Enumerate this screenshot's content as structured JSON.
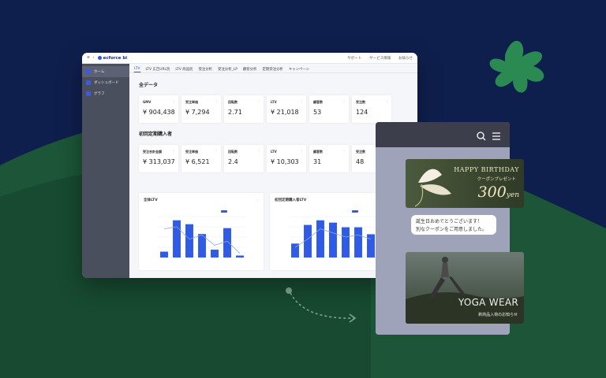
{
  "app": {
    "logo": "ecforce bi"
  },
  "topbar": {
    "support": "サポート",
    "service": "サービス情報",
    "account": "お知らせ"
  },
  "sidebar": {
    "items": [
      {
        "label": "ホーム",
        "active": true
      },
      {
        "label": "ダッシュボード",
        "active": false
      },
      {
        "label": "グラフ",
        "active": false
      }
    ]
  },
  "tabs": [
    "LTV",
    "LTV 広告URL別",
    "LTV 商品別",
    "受注分析",
    "受注分析_LP",
    "顧客分析",
    "定期受注分析",
    "キャンペーン"
  ],
  "section1": {
    "title": "全データ",
    "cards": [
      {
        "label": "GMV",
        "value": "¥ 904,438"
      },
      {
        "label": "受注単価",
        "value": "¥ 7,294"
      },
      {
        "label": "回転数",
        "value": "2.71"
      },
      {
        "label": "LTV",
        "value": "¥ 21,018"
      },
      {
        "label": "顧客数",
        "value": "53"
      },
      {
        "label": "受注数",
        "value": "124"
      }
    ]
  },
  "section2": {
    "title": "初回定期購入者",
    "cards": [
      {
        "label": "受注合計金額",
        "value": "¥ 313,037"
      },
      {
        "label": "受注単価",
        "value": "¥ 6,521"
      },
      {
        "label": "回転数",
        "value": "2.4"
      },
      {
        "label": "LTV",
        "value": "¥ 10,303"
      },
      {
        "label": "顧客数",
        "value": "31"
      },
      {
        "label": "受注数",
        "value": "48"
      }
    ]
  },
  "charts": {
    "left": {
      "title": "全体LTV"
    },
    "right": {
      "title": "初回定期購入者LTV"
    }
  },
  "chart_data": [
    {
      "type": "bar",
      "title": "全体LTV",
      "values": [
        3,
        19,
        17,
        12,
        4,
        15,
        1
      ],
      "line": [
        0.7,
        0.75,
        0.45,
        0.55,
        0.3,
        0.4,
        0.1
      ]
    },
    {
      "type": "bar",
      "title": "初回定期購入者LTV",
      "values": [
        6,
        14,
        16,
        15,
        13,
        13,
        10
      ],
      "line": [
        0.25,
        0.45,
        0.7,
        0.6,
        0.5,
        0.55,
        0.45
      ]
    }
  ],
  "promo": {
    "bday_title": "HAPPY BIRTHDAY",
    "bday_sub": "クーポンプレゼント",
    "bday_amount": "300",
    "bday_unit": "yen",
    "message_line1": "誕生日おめでとうございます！",
    "message_line2": "別なクーポンをご用意しました。",
    "yoga_title": "YOGA WEAR",
    "yoga_sub": "新商品入荷のお知らせ"
  },
  "colors": {
    "navy": "#0f1f4d",
    "green": "#1d5a3a",
    "accent": "#2e55e6"
  }
}
